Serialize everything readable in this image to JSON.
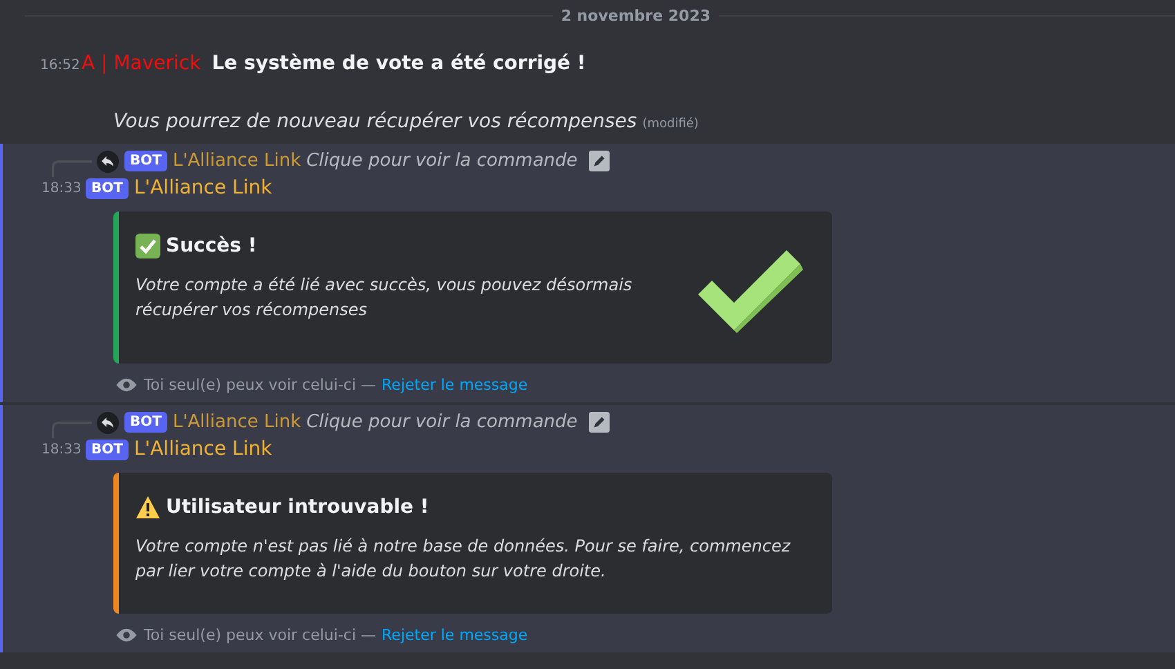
{
  "date_divider": "2 novembre 2023",
  "messages": [
    {
      "kind": "text",
      "time": "16:52",
      "author": "A | Maverick",
      "color": "#f20d0d",
      "headline": "Le système de vote a été corrigé !",
      "body": "Vous pourrez de nouveau récupérer vos récompenses",
      "edited": "(modifié)"
    },
    {
      "kind": "interaction",
      "time": "18:33",
      "bot_tag": "BOT",
      "author": "L'Alliance Link",
      "color": "#f0b232",
      "reply": {
        "bot_tag": "BOT",
        "author": "L'Alliance Link",
        "command": "Clique pour voir la commande"
      },
      "embed": {
        "kind": "success",
        "color": "#23a55a",
        "title": "Succès !",
        "description": "Votre compte a été lié avec succès, vous pouvez désormais récupérer vos récompenses"
      },
      "notice": {
        "text": "Toi seul(e) peux voir celui-ci —",
        "link": "Rejeter le message"
      }
    },
    {
      "kind": "interaction",
      "time": "18:33",
      "bot_tag": "BOT",
      "author": "L'Alliance Link",
      "color": "#f0b232",
      "reply": {
        "bot_tag": "BOT",
        "author": "L'Alliance Link",
        "command": "Clique pour voir la commande"
      },
      "embed": {
        "kind": "warning",
        "color": "#f0861f",
        "title": "Utilisateur introuvable !",
        "description": "Votre compte n'est pas lié à notre base de données. Pour se faire, commencez par lier votre compte à l'aide du bouton sur votre droite."
      },
      "notice": {
        "text": "Toi seul(e) peux voir celui-ci —",
        "link": "Rejeter le message"
      }
    }
  ]
}
